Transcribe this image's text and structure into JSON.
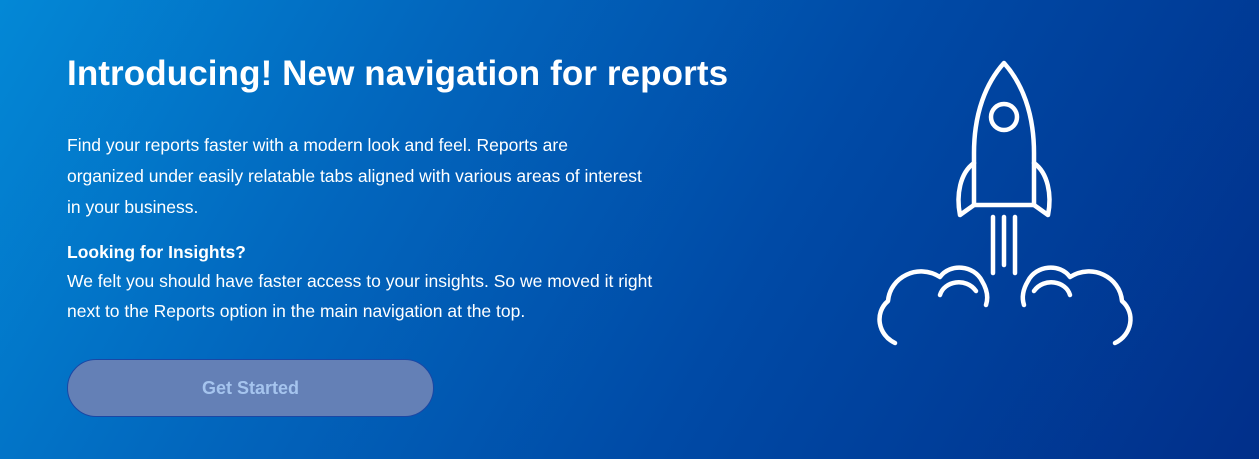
{
  "banner": {
    "title": "Introducing! New navigation for reports",
    "intro": "Find your reports faster with a modern look and feel. Reports are organized under easily relatable tabs aligned with various areas of interest in your business.",
    "subheading": "Looking for Insights?",
    "insights_text": "We felt you should have faster access to your insights. So we moved it right next to the Reports option in the main navigation at the top.",
    "cta_label": "Get Started",
    "illustration_icon": "rocket-launch-icon"
  },
  "colors": {
    "gradient_start": "#0388d6",
    "gradient_end": "#012f8a",
    "text": "#ffffff",
    "button_bg": "#6480b6",
    "button_text": "#a5c4ee"
  }
}
